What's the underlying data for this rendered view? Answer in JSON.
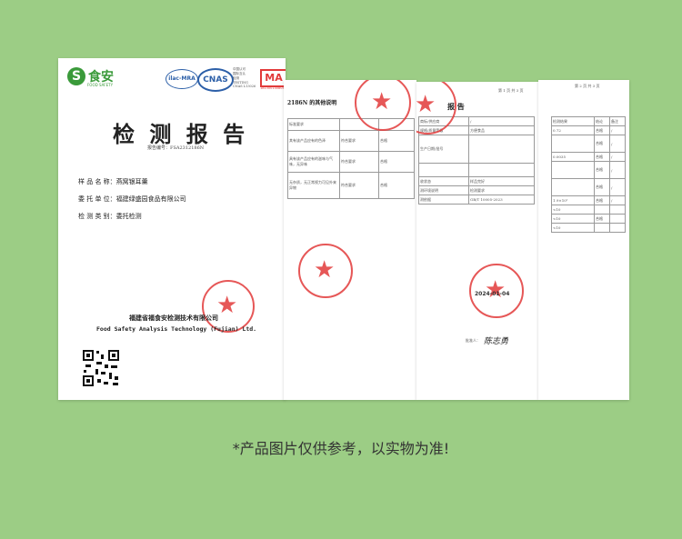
{
  "page1": {
    "brand_name": "食安",
    "brand_sub": "FOOD SAFETY",
    "ilac_label": "ilac-MRA",
    "cnas_label": "CNAS",
    "cnas_side_1": "中国认可",
    "cnas_side_2": "国际互认",
    "cnas_side_3": "检测",
    "cnas_side_4": "TESTING",
    "cnas_side_5": "CNAS L13026",
    "cma_label": "MA",
    "cma_number": "181300140804",
    "title": "检 测 报 告",
    "report_no": "报告编号：FSA2312186N",
    "sample_label": "样 品 名 称：",
    "sample_value": "燕窝银耳羹",
    "client_label": "委 托 单 位：",
    "client_value": "福建绿盛园食品有限公司",
    "category_label": "检 测 类 别：",
    "category_value": "委托检测",
    "org_cn": "福建省福食安检测技术有限公司",
    "org_en": "Food Safety Analysis Technology (Fujian) Ltd."
  },
  "page2": {
    "header": "2186N 的其他说明",
    "col_req": "标准要求",
    "row1": "其有该产品应有的色泽",
    "row2": "具有该产品应有的滋味与气味，无异味",
    "row3": "无杂质，无正常视力可见外来异物",
    "ok": "符合要求",
    "pass": "合格"
  },
  "page3": {
    "title": "报 告",
    "page_no": "第 1 页 共 3 页",
    "r1": "商标/供应商",
    "r2": "规格/质量等级",
    "r3": "生产日期/批号",
    "r4": "收状态",
    "r5": "测环境说明",
    "r6": "测依据",
    "v2": "方便食品",
    "v4": "样品完好",
    "v5": "检测要求",
    "v6": "GB/T 10005-2023",
    "stamp_date": "2024-01-04",
    "approver": "批准人："
  },
  "page4": {
    "page_no": "第 2 页 共 3 页",
    "h1": "检测结果",
    "h2": "结论",
    "h3": "备注",
    "rows": [
      "0.72",
      "0.0035",
      "1.9×10²",
      "<10",
      "<10",
      "<10"
    ],
    "result": "合格"
  },
  "caption": "*产品图片仅供参考，以实物为准!"
}
